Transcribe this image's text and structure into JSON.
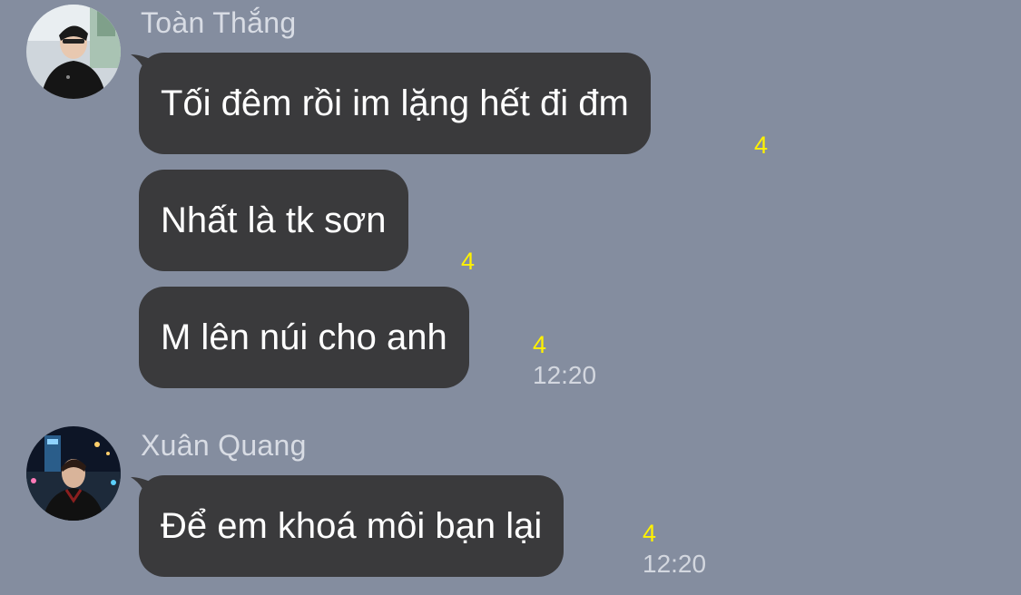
{
  "messages": [
    {
      "sender": "Toàn Thắng",
      "avatar": "toan-thang-avatar",
      "bubbles": [
        {
          "text": "Tối đêm rồi im lặng hết đi đm",
          "unread": "4"
        },
        {
          "text": "Nhất là tk sơn",
          "unread": "4"
        },
        {
          "text": "M lên núi cho anh",
          "unread": "4",
          "time": "12:20"
        }
      ]
    },
    {
      "sender": "Xuân Quang",
      "avatar": "xuan-quang-avatar",
      "bubbles": [
        {
          "text": "Để em khoá môi bạn lại",
          "unread": "4",
          "time": "12:20"
        }
      ]
    }
  ],
  "colors": {
    "background": "#848d9f",
    "bubble": "#3a3a3c",
    "bubble_text": "#ffffff",
    "unread_count": "#fff200",
    "meta_text": "#d3d7df"
  }
}
